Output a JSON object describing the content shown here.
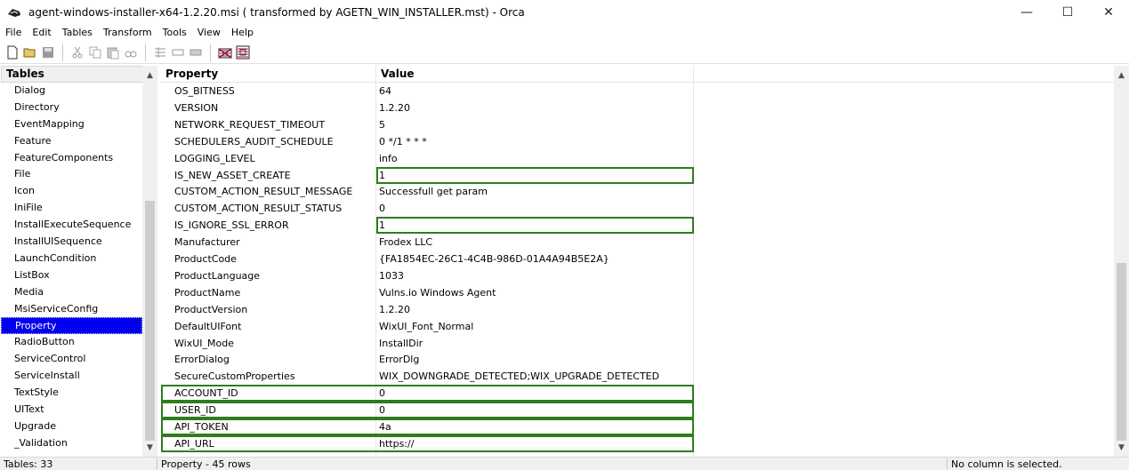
{
  "window": {
    "title": "agent-windows-installer-x64-1.2.20.msi ( transformed by AGETN_WIN_INSTALLER.mst) - Orca",
    "minimize": "—",
    "maximize": "☐",
    "close": "✕"
  },
  "menu": [
    "File",
    "Edit",
    "Tables",
    "Transform",
    "Tools",
    "View",
    "Help"
  ],
  "left": {
    "header": "Tables",
    "items": [
      "Dialog",
      "Directory",
      "EventMapping",
      "Feature",
      "FeatureComponents",
      "File",
      "Icon",
      "IniFile",
      "InstallExecuteSequence",
      "InstallUISequence",
      "LaunchCondition",
      "ListBox",
      "Media",
      "MsiServiceConfig",
      "Property",
      "RadioButton",
      "ServiceControl",
      "ServiceInstall",
      "TextStyle",
      "UIText",
      "Upgrade",
      "_Validation"
    ],
    "selected_index": 14
  },
  "grid": {
    "col_property": "Property",
    "col_value": "Value",
    "rows": [
      {
        "p": "OS_BITNESS",
        "v": "64",
        "hl": false
      },
      {
        "p": "VERSION",
        "v": "1.2.20",
        "hl": false
      },
      {
        "p": "NETWORK_REQUEST_TIMEOUT",
        "v": "5",
        "hl": false
      },
      {
        "p": "SCHEDULERS_AUDIT_SCHEDULE",
        "v": "0 */1 * * *",
        "hl": false
      },
      {
        "p": "LOGGING_LEVEL",
        "v": "info",
        "hl": false
      },
      {
        "p": "IS_NEW_ASSET_CREATE",
        "v": "1",
        "hl": "value"
      },
      {
        "p": "CUSTOM_ACTION_RESULT_MESSAGE",
        "v": "Successfull get param",
        "hl": false
      },
      {
        "p": "CUSTOM_ACTION_RESULT_STATUS",
        "v": "0",
        "hl": false
      },
      {
        "p": "IS_IGNORE_SSL_ERROR",
        "v": "1",
        "hl": "value"
      },
      {
        "p": "Manufacturer",
        "v": "Frodex LLC",
        "hl": false
      },
      {
        "p": "ProductCode",
        "v": "{FA1854EC-26C1-4C4B-986D-01A4A94B5E2A}",
        "hl": false
      },
      {
        "p": "ProductLanguage",
        "v": "1033",
        "hl": false
      },
      {
        "p": "ProductName",
        "v": "Vulns.io Windows Agent",
        "hl": false
      },
      {
        "p": "ProductVersion",
        "v": "1.2.20",
        "hl": false
      },
      {
        "p": "DefaultUIFont",
        "v": "WixUI_Font_Normal",
        "hl": false
      },
      {
        "p": "WixUI_Mode",
        "v": "InstallDir",
        "hl": false
      },
      {
        "p": "ErrorDialog",
        "v": "ErrorDlg",
        "hl": false
      },
      {
        "p": "SecureCustomProperties",
        "v": "WIX_DOWNGRADE_DETECTED;WIX_UPGRADE_DETECTED",
        "hl": false
      },
      {
        "p": "ACCOUNT_ID",
        "v": "0",
        "hl": "row"
      },
      {
        "p": "USER_ID",
        "v": "0",
        "hl": "row"
      },
      {
        "p": "API_TOKEN",
        "v": "4a",
        "hl": "row"
      },
      {
        "p": "API_URL",
        "v": "https://",
        "hl": "row"
      }
    ]
  },
  "status": {
    "tables": "Tables: 33",
    "rows": "Property - 45 rows",
    "column": "No column is selected."
  },
  "colors": {
    "selection": "#0000ee",
    "highlight": "#2e7d1e"
  }
}
